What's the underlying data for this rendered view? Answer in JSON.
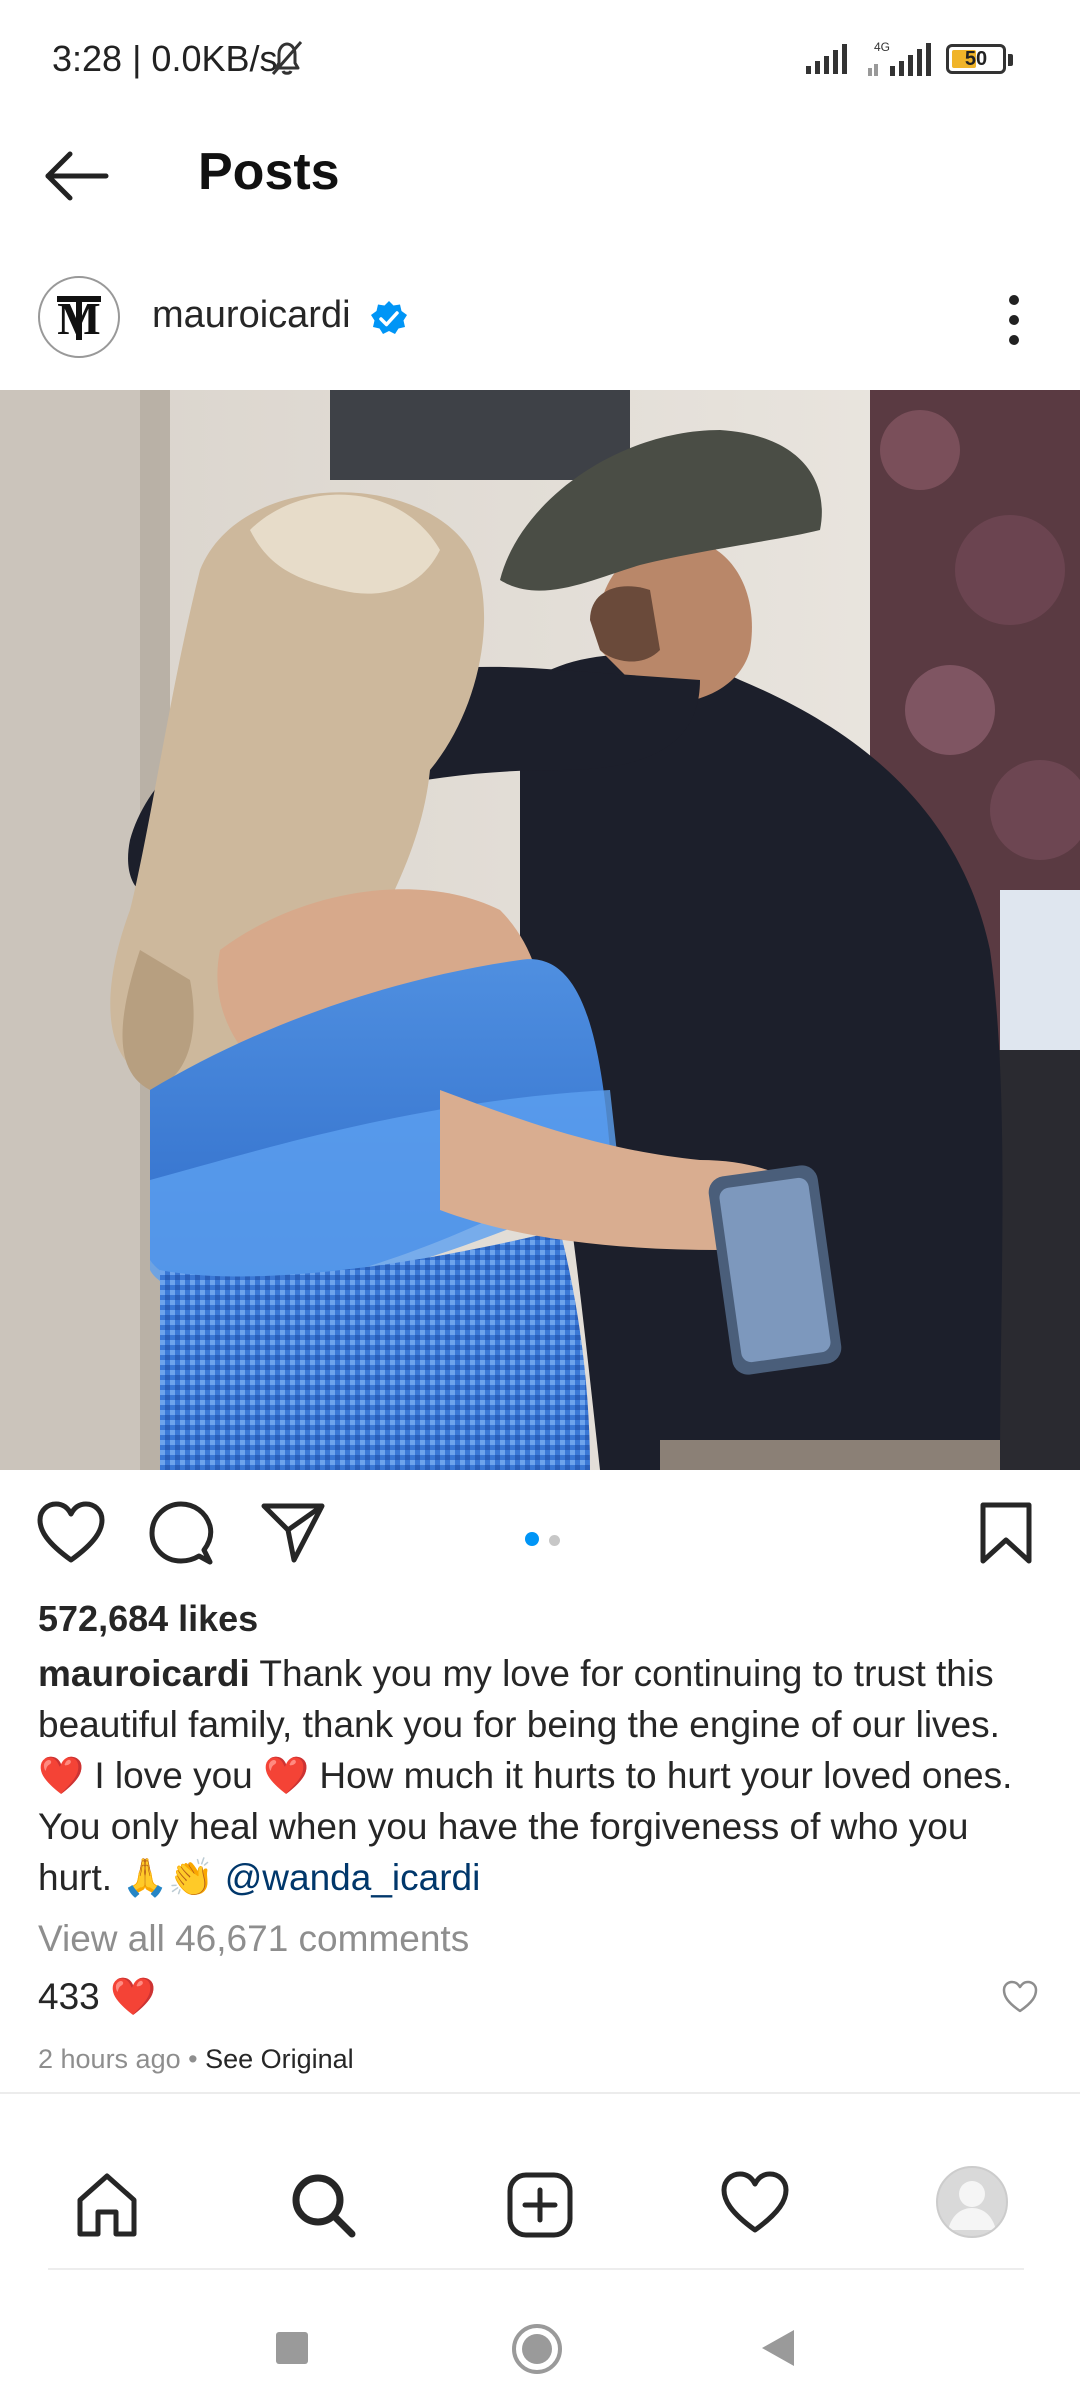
{
  "status_bar": {
    "time_speed": "3:28 | 0.0KB/s",
    "network": "4G",
    "battery": "50",
    "battery_level": 0.5
  },
  "header": {
    "title": "Posts",
    "back_icon": "arrow-left-icon"
  },
  "post": {
    "username": "mauroicardi",
    "verified": true,
    "photo_pages": 2,
    "photo_current_page": 1,
    "likes": "572,684 likes",
    "caption_user": "mauroicardi",
    "caption_text": "Thank you my love for continuing to trust this beautiful family, thank you for being the engine of our lives. ❤️ I love you ❤️ How much it hurts to hurt your loved ones. You only heal when you have the forgiveness of who you hurt. 🙏👏",
    "caption_mention": "@wanda_icardi",
    "view_comments": "View all 46,671 comments",
    "top_comment": "433 ❤️",
    "time_ago": "2 hours ago",
    "separator": "•",
    "see_original": "See Original"
  },
  "icons": [
    "heart-icon",
    "comment-icon",
    "share-icon",
    "bookmark-icon",
    "home-icon",
    "search-icon",
    "add-post-icon",
    "activity-heart-icon",
    "profile-avatar",
    "more-options-icon"
  ],
  "colors": {
    "accent": "#0095f6",
    "dot_inactive": "#c7c7c7",
    "mention": "#00376b",
    "heart_emoji": "#e0245e"
  }
}
